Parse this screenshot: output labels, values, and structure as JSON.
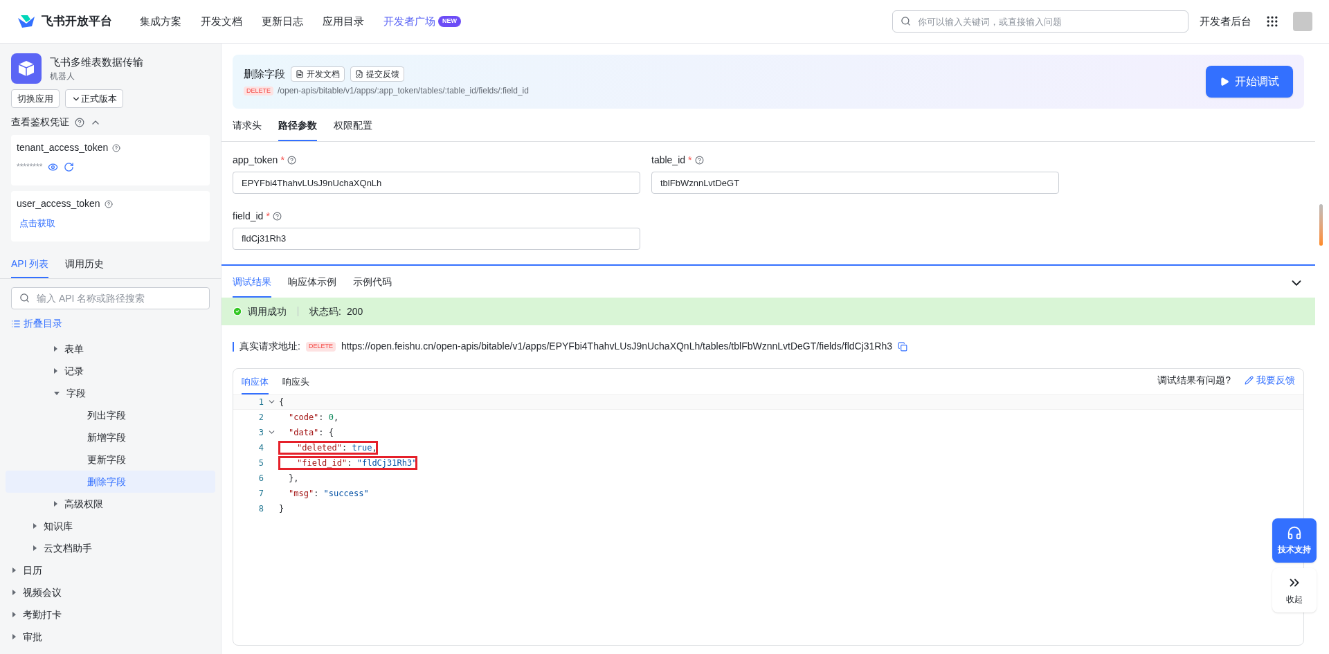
{
  "topbar": {
    "brand": "飞书开放平台",
    "nav": [
      {
        "label": "集成方案",
        "selected": false
      },
      {
        "label": "开发文档",
        "selected": false
      },
      {
        "label": "更新日志",
        "selected": false
      },
      {
        "label": "应用目录",
        "selected": false
      },
      {
        "label": "开发者广场",
        "selected": true,
        "badge": "NEW"
      }
    ],
    "search": {
      "placeholder": "你可以输入关键词，或直接输入问题"
    },
    "console": "开发者后台"
  },
  "app": {
    "name": "飞书多维表数据传输",
    "type": "机器人",
    "buttons": [
      {
        "label": "切换应用",
        "kind": "plain"
      },
      {
        "label": "正式版本",
        "kind": "dropdown"
      }
    ]
  },
  "credentials": {
    "title": "查看鉴权凭证",
    "expanded": true,
    "tokens": [
      {
        "name": "tenant_access_token",
        "kind": "masked",
        "value": "********"
      },
      {
        "name": "user_access_token",
        "kind": "link",
        "link": "点击获取"
      }
    ]
  },
  "sidebar_tabs": [
    {
      "label": "API 列表",
      "selected": true
    },
    {
      "label": "调用历史",
      "selected": false
    }
  ],
  "api_search": {
    "placeholder": "输入 API 名称或路径搜索"
  },
  "collapse_all": "折叠目录",
  "tree": [
    {
      "children": [
        {
          "children": [
            {
              "label": "表单",
              "expanded": false,
              "selected": false
            },
            {
              "label": "记录",
              "expanded": false,
              "selected": false
            },
            {
              "label": "字段",
              "expanded": true,
              "selected": false,
              "children": [
                {
                  "label": "列出字段",
                  "selected": false
                },
                {
                  "label": "新增字段",
                  "selected": false
                },
                {
                  "label": "更新字段",
                  "selected": false
                },
                {
                  "label": "删除字段",
                  "selected": true
                }
              ]
            },
            {
              "label": "高级权限",
              "expanded": false,
              "selected": false
            }
          ]
        },
        {
          "label": "知识库",
          "expanded": false,
          "selected": false
        },
        {
          "label": "云文档助手",
          "expanded": false,
          "selected": false
        }
      ]
    },
    {
      "label": "日历",
      "expanded": false,
      "selected": false
    },
    {
      "label": "视频会议",
      "expanded": false,
      "selected": false
    },
    {
      "label": "考勤打卡",
      "expanded": false,
      "selected": false
    },
    {
      "label": "审批",
      "expanded": false,
      "selected": false
    }
  ],
  "api": {
    "title": "删除字段",
    "links": [
      "开发文档",
      "提交反馈"
    ],
    "method": "DELETE",
    "path": "/open-apis/bitable/v1/apps/:app_token/tables/:table_id/fields/:field_id",
    "run_button": "开始调试"
  },
  "param_tabs": [
    {
      "label": "请求头",
      "selected": false
    },
    {
      "label": "路径参数",
      "selected": true
    },
    {
      "label": "权限配置",
      "selected": false
    }
  ],
  "params": [
    {
      "name": "app_token",
      "required_mark": "*",
      "value": "EPYFbi4ThahvLUsJ9nUchaXQnLh"
    },
    {
      "name": "table_id",
      "required_mark": "*",
      "value": "tblFbWznnLvtDeGT"
    },
    {
      "name": "field_id",
      "required_mark": "*",
      "value": "fldCj31Rh3"
    }
  ],
  "result_tabs": [
    {
      "label": "调试结果",
      "selected": true
    },
    {
      "label": "响应体示例",
      "selected": false
    },
    {
      "label": "示例代码",
      "selected": false
    }
  ],
  "status": {
    "message": "调用成功",
    "code_label": "状态码:",
    "code": "200"
  },
  "request_url": {
    "label": "真实请求地址:",
    "method": "DELETE",
    "url": "https://open.feishu.cn/open-apis/bitable/v1/apps/EPYFbi4ThahvLUsJ9nUchaXQnLh/tables/tblFbWznnLvtDeGT/fields/fldCj31Rh3"
  },
  "response": {
    "tabs": [
      {
        "label": "响应体",
        "selected": true
      },
      {
        "label": "响应头",
        "selected": false
      }
    ],
    "question": "调试结果有问题?",
    "feedback": "我要反馈",
    "lines": [
      {
        "number": "1",
        "kind": "foldable",
        "highlighted": false,
        "tokens": [
          {
            "kind": "punct",
            "text": "{"
          }
        ]
      },
      {
        "number": "2",
        "kind": "plain",
        "highlighted": false,
        "tokens": [
          {
            "kind": "key",
            "text": "\"code\""
          },
          {
            "kind": "punct",
            "text": ": "
          },
          {
            "kind": "number",
            "text": "0"
          },
          {
            "kind": "punct",
            "text": ","
          }
        ]
      },
      {
        "number": "3",
        "kind": "foldable",
        "highlighted": false,
        "tokens": [
          {
            "kind": "key",
            "text": "\"data\""
          },
          {
            "kind": "punct",
            "text": ": {"
          }
        ]
      },
      {
        "number": "4",
        "kind": "plain",
        "highlighted": true,
        "tokens": [
          {
            "kind": "key",
            "text": "\"deleted\""
          },
          {
            "kind": "punct",
            "text": ": "
          },
          {
            "kind": "literal",
            "text": "true"
          },
          {
            "kind": "punct",
            "text": ","
          }
        ]
      },
      {
        "number": "5",
        "kind": "plain",
        "highlighted": true,
        "tokens": [
          {
            "kind": "key",
            "text": "\"field_id\""
          },
          {
            "kind": "punct",
            "text": ": "
          },
          {
            "kind": "string",
            "text": "\"fldCj31Rh3\""
          }
        ]
      },
      {
        "number": "6",
        "kind": "plain",
        "highlighted": false,
        "tokens": [
          {
            "kind": "punct",
            "text": "},"
          }
        ]
      },
      {
        "number": "7",
        "kind": "plain",
        "highlighted": false,
        "tokens": [
          {
            "kind": "key",
            "text": "\"msg\""
          },
          {
            "kind": "punct",
            "text": ": "
          },
          {
            "kind": "string",
            "text": "\"success\""
          }
        ]
      },
      {
        "number": "8",
        "kind": "plain",
        "highlighted": false,
        "tokens": [
          {
            "kind": "punct",
            "text": "}"
          }
        ]
      }
    ]
  },
  "float_buttons": [
    {
      "label": "技术支持",
      "kind": "support"
    },
    {
      "label": "收起",
      "kind": "collapse"
    }
  ]
}
